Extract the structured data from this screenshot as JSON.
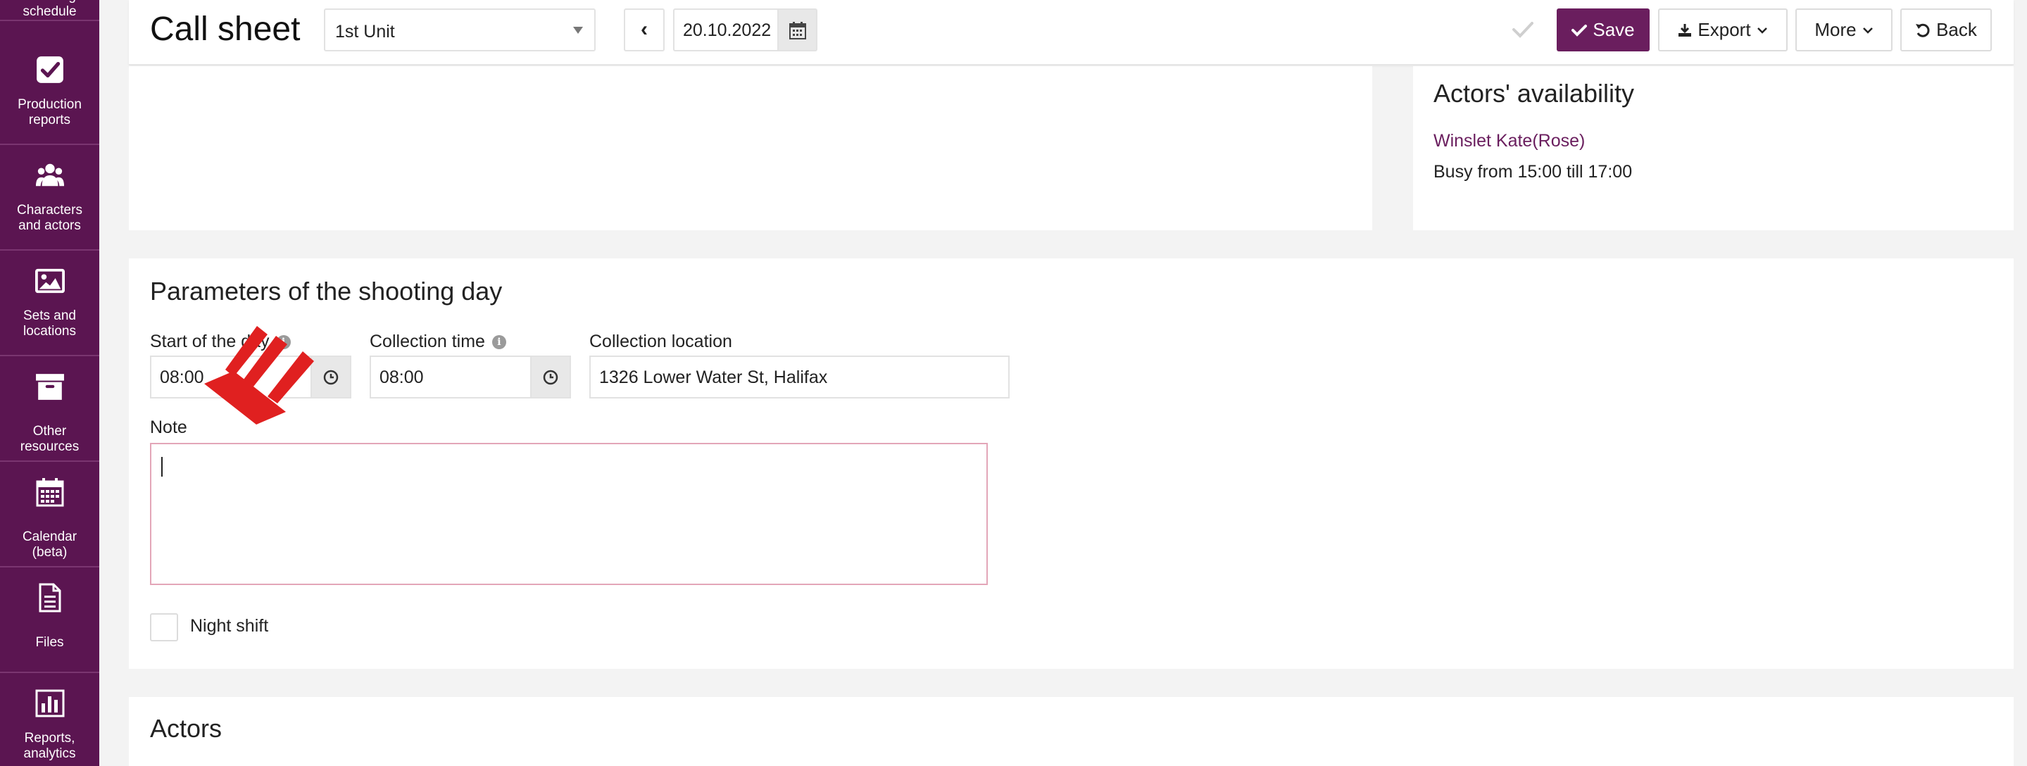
{
  "sidebar": {
    "items": [
      {
        "label": "Shooting schedule",
        "icon": "clipboard-icon"
      },
      {
        "label": "Production reports",
        "icon": "checkbox-icon"
      },
      {
        "label": "Characters and actors",
        "icon": "users-icon"
      },
      {
        "label": "Sets and locations",
        "icon": "image-icon"
      },
      {
        "label": "Other resources",
        "icon": "archive-icon"
      },
      {
        "label": "Calendar (beta)",
        "icon": "calendar-icon"
      },
      {
        "label": "Files",
        "icon": "file-icon"
      },
      {
        "label": "Reports, analytics",
        "icon": "bar-chart-icon"
      }
    ]
  },
  "header": {
    "title": "Call sheet",
    "unit_selected": "1st Unit",
    "prev_label": "‹",
    "date": "20.10.2022",
    "save_label": "Save",
    "export_label": "Export",
    "more_label": "More",
    "back_label": "Back"
  },
  "availability": {
    "title": "Actors' availability",
    "actor_name": "Winslet Kate(Rose)",
    "busy_text": "Busy from 15:00 till 17:00"
  },
  "params": {
    "title": "Parameters of the shooting day",
    "start_label": "Start of the day",
    "start_value": "08:00",
    "collection_time_label": "Collection time",
    "collection_time_value": "08:00",
    "collection_location_label": "Collection location",
    "collection_location_value": "1326 Lower Water St, Halifax",
    "note_label": "Note",
    "note_value": "",
    "night_shift_label": "Night shift"
  },
  "actors_section": {
    "title": "Actors"
  },
  "colors": {
    "sidebar_bg": "#5b1551",
    "accent": "#6a1e5e",
    "annotation_arrow": "#e02020"
  }
}
